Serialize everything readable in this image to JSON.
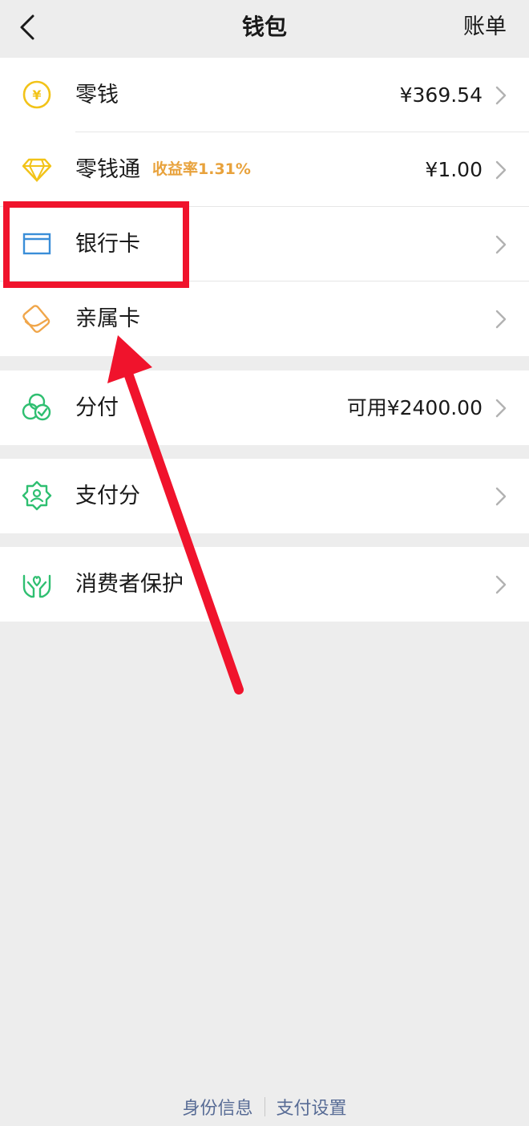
{
  "header": {
    "title": "钱包",
    "right_label": "账单"
  },
  "group1": {
    "items": [
      {
        "label": "零钱",
        "value": "¥369.54",
        "icon": "yuan-coin-icon"
      },
      {
        "label": "零钱通",
        "badge": "收益率1.31%",
        "value": "¥1.00",
        "icon": "diamond-icon"
      },
      {
        "label": "银行卡",
        "icon": "bank-card-icon"
      },
      {
        "label": "亲属卡",
        "icon": "family-card-icon"
      }
    ]
  },
  "group2": {
    "label": "分付",
    "value": "可用¥2400.00",
    "icon": "fenfu-icon"
  },
  "group3": {
    "label": "支付分",
    "icon": "pay-score-icon"
  },
  "group4": {
    "label": "消费者保护",
    "icon": "consumer-protection-icon"
  },
  "footer": {
    "identity_label": "身份信息",
    "settings_label": "支付设置"
  },
  "colors": {
    "background": "#ededed",
    "link": "#576b95",
    "badge": "#e8a23c",
    "highlight_annotation": "#f0132c",
    "icon_yellow": "#f2c318",
    "icon_blue": "#3a8ed8",
    "icon_orange": "#f0a64a",
    "icon_green": "#2fbf71"
  }
}
